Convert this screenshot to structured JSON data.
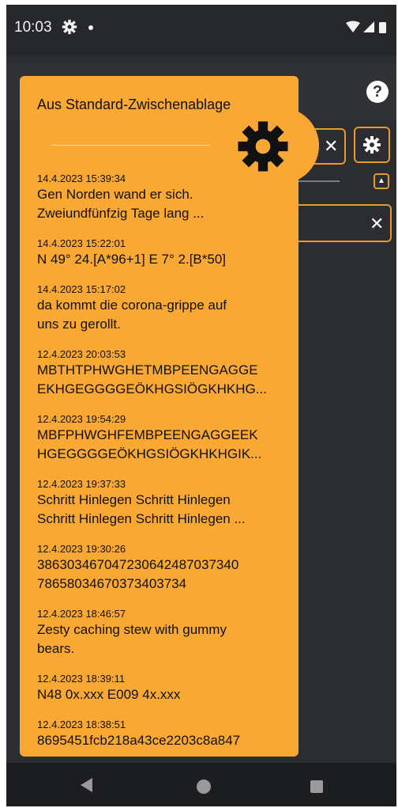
{
  "status_bar": {
    "time": "10:03"
  },
  "popup": {
    "title": "Aus Standard-Zwischenablage",
    "items": [
      {
        "date": "14.4.2023 15:39:34",
        "text": "Gen Norden wand er sich.",
        "text2": "Zweiundfünfzig Tage lang ..."
      },
      {
        "date": "14.4.2023 15:22:01",
        "text": "N 49° 24.[A*96+1] E 7° 2.[B*50]",
        "text2": ""
      },
      {
        "date": "14.4.2023 15:17:02",
        "text": "da kommt die corona-grippe auf",
        "text2": "uns zu gerollt."
      },
      {
        "date": "12.4.2023 20:03:53",
        "text": "MBTHTPHWGHETMBPEENGAGGE",
        "text2": "EKHGEGGGGEÖKHGSIÖGKHKHG..."
      },
      {
        "date": "12.4.2023 19:54:29",
        "text": "MBFPHWGHFEMBPEENGAGGEEK",
        "text2": "HGEGGGGEÖKHGSIÖGKHKHGIK..."
      },
      {
        "date": "12.4.2023 19:37:33",
        "text": "Schritt Hinlegen Schritt Hinlegen",
        "text2": "Schritt Hinlegen Schritt Hinlegen ..."
      },
      {
        "date": "12.4.2023 19:30:26",
        "text": "38630346704723064248703734​0",
        "text2": "78658034670373403734"
      },
      {
        "date": "12.4.2023 18:46:57",
        "text": "Zesty caching stew with gummy",
        "text2": "bears."
      },
      {
        "date": "12.4.2023 18:39:11",
        "text": "N48 0x.xxx E009 4x.xxx",
        "text2": ""
      },
      {
        "date": "12.4.2023 18:38:51",
        "text": "8695451fcb218a43ce2203c8a847",
        "text2": ""
      }
    ]
  },
  "icons": {
    "help": "question-circle-icon",
    "clear": "close-icon",
    "settings": "gear-icon",
    "collapse": "chevron-up-icon"
  },
  "colors": {
    "accent": "#f9a834",
    "background": "#2b2d31"
  }
}
